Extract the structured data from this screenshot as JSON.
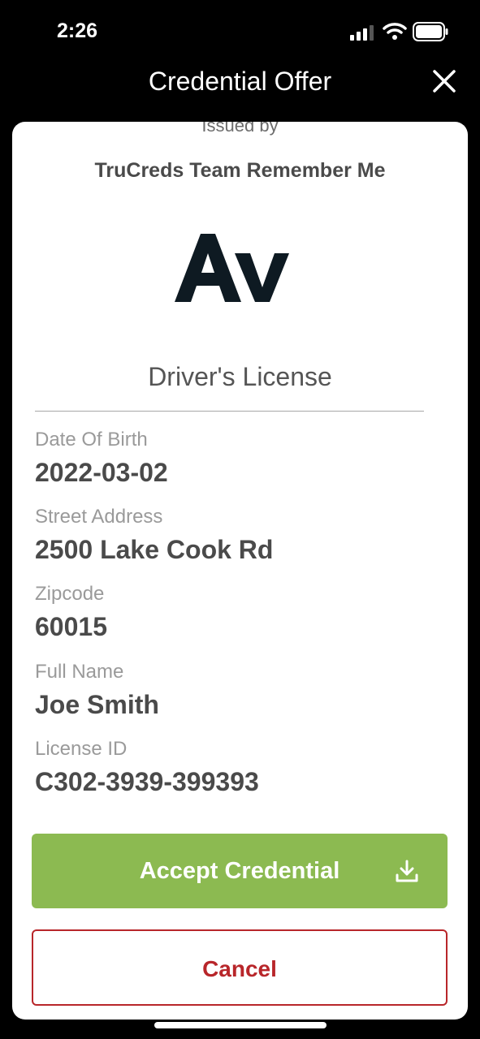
{
  "status_bar": {
    "time": "2:26"
  },
  "header": {
    "title": "Credential Offer"
  },
  "card": {
    "issued_by_label": "Issued by",
    "issuer_name": "TruCreds Team Remember Me",
    "logo_text": "Av",
    "credential_type": "Driver's License",
    "fields": [
      {
        "label": "Date Of Birth",
        "value": "2022-03-02"
      },
      {
        "label": "Street Address",
        "value": "2500 Lake Cook Rd"
      },
      {
        "label": "Zipcode",
        "value": "60015"
      },
      {
        "label": "Full Name",
        "value": "Joe Smith"
      },
      {
        "label": "License ID",
        "value": "C302-3939-399393"
      }
    ]
  },
  "actions": {
    "accept_label": "Accept Credential",
    "cancel_label": "Cancel"
  },
  "colors": {
    "accept": "#8cba51",
    "cancel": "#b8262a",
    "logo": "#0e1a22"
  },
  "icons": [
    "signal-icon",
    "wifi-icon",
    "battery-icon",
    "close-icon",
    "download-icon"
  ]
}
